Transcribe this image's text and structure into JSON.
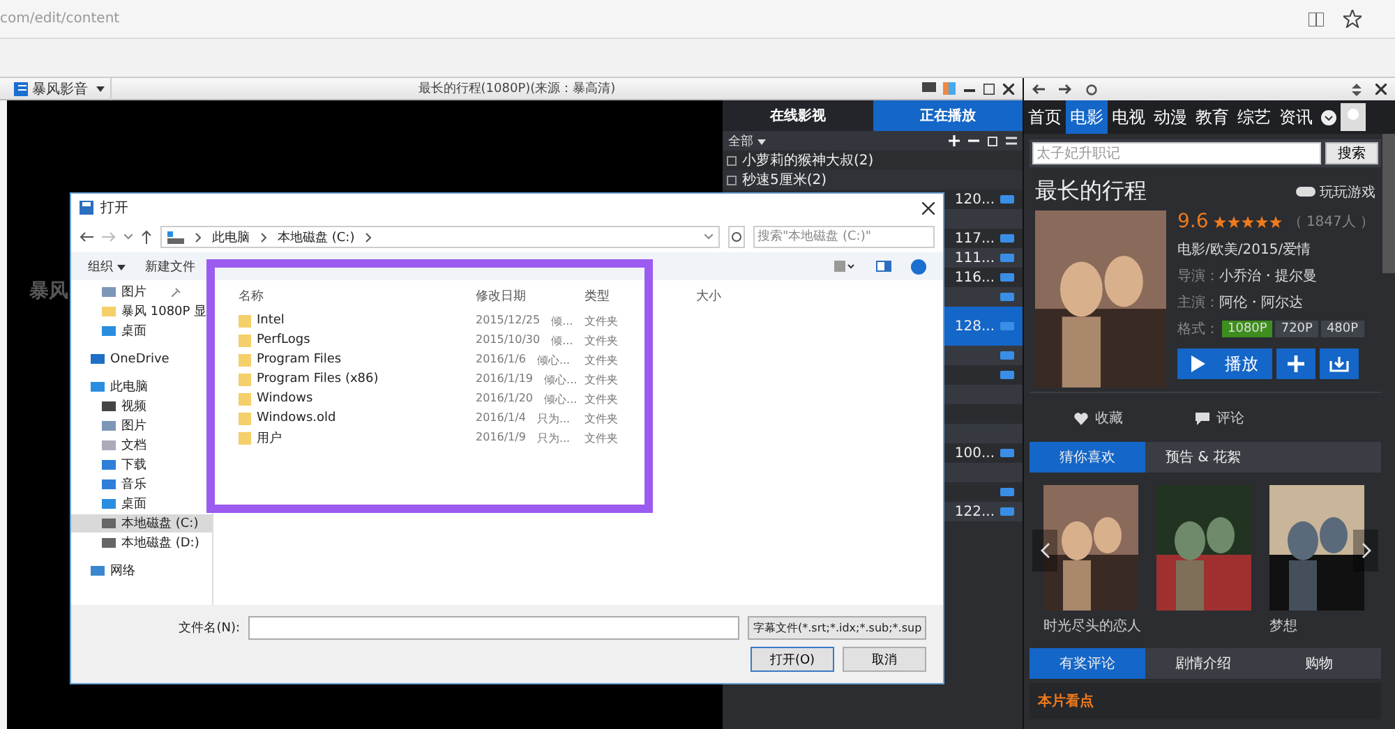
{
  "browser": {
    "url": "com/edit/content"
  },
  "player": {
    "menu": "暴风影音",
    "title": "最长的行程(1080P)(来源：暴高清)",
    "video_mark": "暴风"
  },
  "playlist": {
    "tabs": [
      {
        "label": "在线影视",
        "selected": false
      },
      {
        "label": "正在播放",
        "selected": true
      }
    ],
    "filter": "全部",
    "groups": [
      {
        "label": "小萝莉的猴神大叔(2)"
      },
      {
        "label": "秒速5厘米(2)"
      }
    ],
    "rows": [
      {
        "label": "120...",
        "hd": true,
        "selected": false
      },
      {
        "hd": false,
        "selected": false
      },
      {
        "label": "117...",
        "hd": true,
        "selected": false
      },
      {
        "label": "111...",
        "hd": true,
        "selected": false
      },
      {
        "label": "116...",
        "hd": true,
        "selected": false
      },
      {
        "hd": true,
        "selected": false
      },
      {
        "label": "128...",
        "hd": true,
        "selected": true
      },
      {
        "hd": true,
        "selected": false
      },
      {
        "hd": true,
        "selected": false
      },
      {
        "hd": false,
        "selected": false
      },
      {
        "hd": false,
        "selected": false
      },
      {
        "hd": false,
        "selected": false
      },
      {
        "label": "100...",
        "hd": true,
        "selected": false
      },
      {
        "hd": false,
        "selected": false
      },
      {
        "hd": true,
        "selected": false
      },
      {
        "label": "122...",
        "hd": true,
        "selected": false
      }
    ]
  },
  "dialog": {
    "title": "打开",
    "path": [
      "此电脑",
      "本地磁盘 (C:)"
    ],
    "search": {
      "placeholder": "搜索\"本地磁盘 (C:)\""
    },
    "toolbar": [
      "组织",
      "新建文件"
    ],
    "quick_access": [
      {
        "label": "图片",
        "kind": "pictures",
        "pinned": true
      },
      {
        "label": "暴风 1080P 显",
        "kind": "folder",
        "pinned": false
      },
      {
        "label": "桌面",
        "kind": "desktop",
        "pinned": false
      }
    ],
    "nav": [
      {
        "label": "OneDrive",
        "kind": "cloud",
        "selected": false
      },
      {
        "label": "此电脑",
        "kind": "computer",
        "selected": false,
        "children": [
          {
            "label": "视频",
            "kind": "videos",
            "selected": false
          },
          {
            "label": "图片",
            "kind": "pictures",
            "selected": false
          },
          {
            "label": "文档",
            "kind": "documents",
            "selected": false
          },
          {
            "label": "下载",
            "kind": "downloads",
            "selected": false
          },
          {
            "label": "音乐",
            "kind": "music",
            "selected": false
          },
          {
            "label": "桌面",
            "kind": "desktop",
            "selected": false
          },
          {
            "label": "本地磁盘 (C:)",
            "kind": "drive",
            "selected": true
          },
          {
            "label": "本地磁盘 (D:)",
            "kind": "drive",
            "selected": false
          }
        ]
      },
      {
        "label": "网络",
        "kind": "network",
        "selected": false
      }
    ],
    "columns": [
      "名称",
      "修改日期",
      "类型",
      "大小"
    ],
    "files": [
      {
        "name": "Intel",
        "modified": "2015/12/25",
        "note": "倾...",
        "type": "文件夹"
      },
      {
        "name": "PerfLogs",
        "modified": "2015/10/30",
        "note": "倾...",
        "type": "文件夹"
      },
      {
        "name": "Program Files",
        "modified": "2016/1/6",
        "note": "倾心...",
        "type": "文件夹"
      },
      {
        "name": "Program Files (x86)",
        "modified": "2016/1/19",
        "note": "倾心...",
        "type": "文件夹"
      },
      {
        "name": "Windows",
        "modified": "2016/1/20",
        "note": "倾心...",
        "type": "文件夹"
      },
      {
        "name": "Windows.old",
        "modified": "2016/1/4",
        "note": "只为...",
        "type": "文件夹"
      },
      {
        "name": "用户",
        "modified": "2016/1/9",
        "note": "只为...",
        "type": "文件夹"
      }
    ],
    "filename_label": "文件名(N):",
    "filter": "字幕文件(*.srt;*.idx;*.sub;*.sup",
    "buttons": [
      "打开(O)",
      "取消"
    ]
  },
  "side": {
    "nav": [
      {
        "label": "首页",
        "selected": false
      },
      {
        "label": "电影",
        "selected": true
      },
      {
        "label": "电视",
        "selected": false
      },
      {
        "label": "动漫",
        "selected": false
      },
      {
        "label": "教育",
        "selected": false
      },
      {
        "label": "综艺",
        "selected": false
      },
      {
        "label": "资讯",
        "selected": false
      }
    ],
    "search": {
      "placeholder": "太子妃升职记",
      "button": "搜索"
    },
    "movie": {
      "title": "最长的行程",
      "game_link": "玩玩游戏",
      "score": "9.6",
      "stars": 5,
      "votes": "（ 1847人 ）",
      "genre": "电影/欧美/2015/爱情",
      "director_label": "导演：",
      "director": "小乔治・提尔曼",
      "cast_label": "主演：",
      "cast": "阿伦・阿尔达",
      "format_label": "格式：",
      "formats": [
        {
          "label": "1080P",
          "selected": true
        },
        {
          "label": "720P",
          "selected": false
        },
        {
          "label": "480P",
          "selected": false
        }
      ],
      "play": "播放"
    },
    "actions": [
      "收藏",
      "评论"
    ],
    "tabs": [
      {
        "label": "猜你喜欢",
        "selected": true
      },
      {
        "label": "预告 & 花絮",
        "selected": false
      }
    ],
    "recommend": [
      {
        "kind": "picture",
        "caption": "时光尽头的恋人"
      },
      {
        "kind": "picture"
      },
      {
        "kind": "picture",
        "caption": "梦想"
      }
    ],
    "bottom_tabs": [
      {
        "label": "有奖评论",
        "selected": true
      },
      {
        "label": "剧情介绍",
        "selected": false
      },
      {
        "label": "购物",
        "selected": false
      }
    ],
    "section": "本片看点"
  }
}
